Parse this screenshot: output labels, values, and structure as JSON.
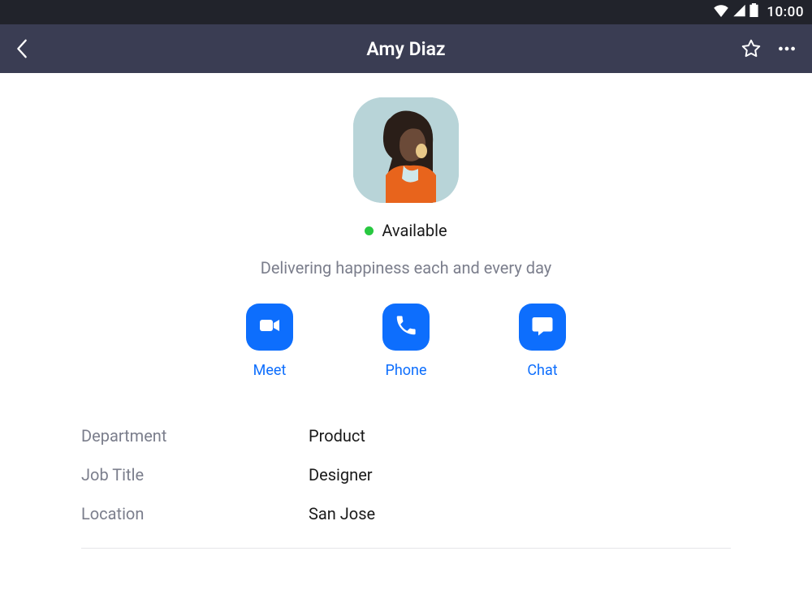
{
  "statusbar": {
    "time": "10:00"
  },
  "header": {
    "title": "Amy Diaz"
  },
  "profile": {
    "status_text": "Available",
    "status_color": "#28c840",
    "tagline": "Delivering happiness each and every day"
  },
  "actions": {
    "meet": "Meet",
    "phone": "Phone",
    "chat": "Chat"
  },
  "details": {
    "department_label": "Department",
    "department_value": "Product",
    "job_title_label": "Job Title",
    "job_title_value": "Designer",
    "location_label": "Location",
    "location_value": "San Jose"
  },
  "colors": {
    "accent": "#0d6efd",
    "header_bg": "#3a3d53",
    "statusbar_bg": "#21232b"
  }
}
